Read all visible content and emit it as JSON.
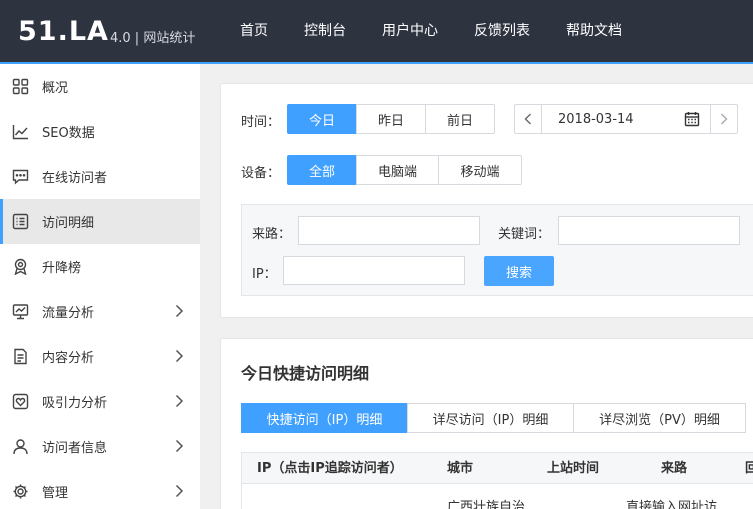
{
  "header": {
    "logo": "51.LA",
    "version": "4.0 | 网站统计",
    "nav": [
      "首页",
      "控制台",
      "用户中心",
      "反馈列表",
      "帮助文档"
    ]
  },
  "sidebar": {
    "items": [
      {
        "label": "概况",
        "icon": "grid-icon",
        "arrow": false,
        "active": false
      },
      {
        "label": "SEO数据",
        "icon": "line-chart-icon",
        "arrow": false,
        "active": false
      },
      {
        "label": "在线访问者",
        "icon": "chat-icon",
        "arrow": false,
        "active": false
      },
      {
        "label": "访问明细",
        "icon": "list-icon",
        "arrow": false,
        "active": true
      },
      {
        "label": "升降榜",
        "icon": "medal-icon",
        "arrow": false,
        "active": false
      },
      {
        "label": "流量分析",
        "icon": "monitor-icon",
        "arrow": true,
        "active": false
      },
      {
        "label": "内容分析",
        "icon": "document-icon",
        "arrow": true,
        "active": false
      },
      {
        "label": "吸引力分析",
        "icon": "heart-icon",
        "arrow": true,
        "active": false
      },
      {
        "label": "访问者信息",
        "icon": "user-icon",
        "arrow": true,
        "active": false
      },
      {
        "label": "管理",
        "icon": "gear-icon",
        "arrow": true,
        "active": false
      }
    ]
  },
  "filter": {
    "time_label": "时间：",
    "time_options": [
      "今日",
      "昨日",
      "前日"
    ],
    "time_selected": "今日",
    "date": "2018-03-14",
    "device_label": "设备：",
    "device_options": [
      "全部",
      "电脑端",
      "移动端"
    ],
    "device_selected": "全部",
    "source_label": "来路：",
    "source_value": "",
    "keyword_label": "关键词：",
    "keyword_value": "",
    "ip_label": "IP：",
    "ip_value": "",
    "search_label": "搜索"
  },
  "list": {
    "title": "今日快捷访问明细",
    "tabs": [
      "快捷访问（IP）明细",
      "详尽访问（IP）明细",
      "详尽浏览（PV）明细"
    ],
    "tab_selected": 0,
    "columns": [
      "IP（点击IP追踪访问者）",
      "城市",
      "上站时间",
      "来路",
      "回"
    ],
    "rows": [
      {
        "ip": "",
        "city": "广西壮族自治",
        "time": "",
        "source": "直接输入网址访",
        "back": ""
      }
    ]
  },
  "colors": {
    "accent": "#40a0ff",
    "header_bg": "#2e3340",
    "active_item_bg": "#e8e8e8"
  }
}
